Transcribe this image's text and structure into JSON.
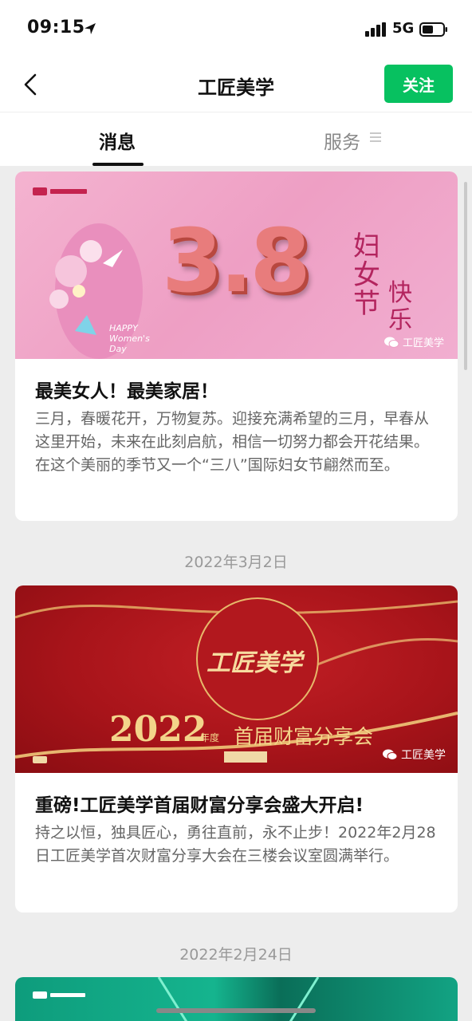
{
  "status_bar": {
    "time": "09:15",
    "network": "5G"
  },
  "nav": {
    "title": "工匠美学",
    "follow_label": "关注"
  },
  "tabs": [
    {
      "label": "消息",
      "active": true
    },
    {
      "label": "服务",
      "active": false
    }
  ],
  "articles": [
    {
      "title": "最美女人！最美家居！",
      "desc": "三月，春暖花开，万物复苏。迎接充满希望的三月，早春从这里开始，未来在此刻启航，相信一切努力都会开花结果。在这个美丽的季节又一个“三八”国际妇女节翩然而至。",
      "cover": {
        "big_text": "3.8",
        "side_text_1": "妇女节",
        "side_text_2": "快乐",
        "english": "HAPPY Women's Day",
        "watermark": "工匠美学"
      }
    },
    {
      "date": "2022年3月2日",
      "title": "重磅!工匠美学首届财富分享会盛大开启!",
      "desc": "持之以恒，独具匠心，勇往直前，永不止步！2022年2月28日工匠美学首次财富分享大会在三楼会议室圆满举行。",
      "cover": {
        "logo_text": "工匠美学",
        "year": "2022",
        "year_suffix": "年度",
        "event": "首届财富分享会",
        "watermark": "工匠美学"
      }
    },
    {
      "date": "2022年2月24日"
    }
  ],
  "colors": {
    "accent": "#07c160",
    "background": "#ededed"
  }
}
